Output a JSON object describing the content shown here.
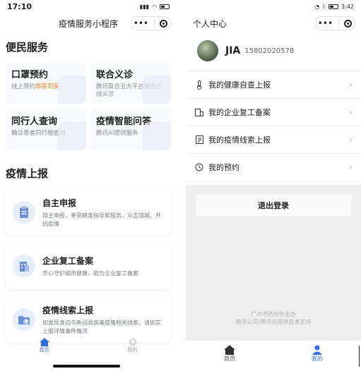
{
  "left": {
    "status": {
      "time": "17:10"
    },
    "nav": {
      "title": "疫情服务小程序"
    },
    "section_services": "便民服务",
    "services": [
      {
        "title": "口罩预约",
        "desc_pre": "线上预约",
        "desc_hl": "邮寄到家"
      },
      {
        "title": "联合义诊",
        "desc_pre": "腾讯联合五大平台提供在线义诊",
        "desc_hl": ""
      },
      {
        "title": "同行人查询",
        "desc_pre": "确诊患者同行程查询",
        "desc_hl": ""
      },
      {
        "title": "疫情智能问答",
        "desc_pre": "腾讯AI提供服务",
        "desc_hl": ""
      }
    ],
    "section_report": "疫情上报",
    "reports": [
      {
        "title": "自主申报",
        "desc": "自主申报，享受精准指导和服务。众志成城、共抗疫情"
      },
      {
        "title": "企业复工备案",
        "desc": "齐心守护城市健康，助力企业复工备案"
      },
      {
        "title": "疫情线索上报",
        "desc": "如发现身边与新冠状病毒疫情相关线索，请如实上报详情事件情况"
      }
    ],
    "tabs": [
      {
        "label": "首页"
      },
      {
        "label": "我的"
      }
    ]
  },
  "right": {
    "status": {
      "time": "3:42"
    },
    "nav": {
      "title": "个人中心"
    },
    "user": {
      "name": "JIA",
      "phone": "15802020578"
    },
    "menu": [
      {
        "label": "我的健康自查上报",
        "icon": "thermometer-icon"
      },
      {
        "label": "我的企业复工备案",
        "icon": "building-icon"
      },
      {
        "label": "我的疫情线索上报",
        "icon": "document-icon"
      },
      {
        "label": "我的预约",
        "icon": "calendar-icon"
      }
    ],
    "logout": "退出登录",
    "footer_line1": "广州市防控办主办",
    "footer_line2": "腾讯公司/腾讯云提供技术支持",
    "tabs": [
      {
        "label": "首页"
      },
      {
        "label": "我的"
      }
    ]
  },
  "colors": {
    "accent": "#2f6fe0",
    "highlight": "#f08a24"
  }
}
